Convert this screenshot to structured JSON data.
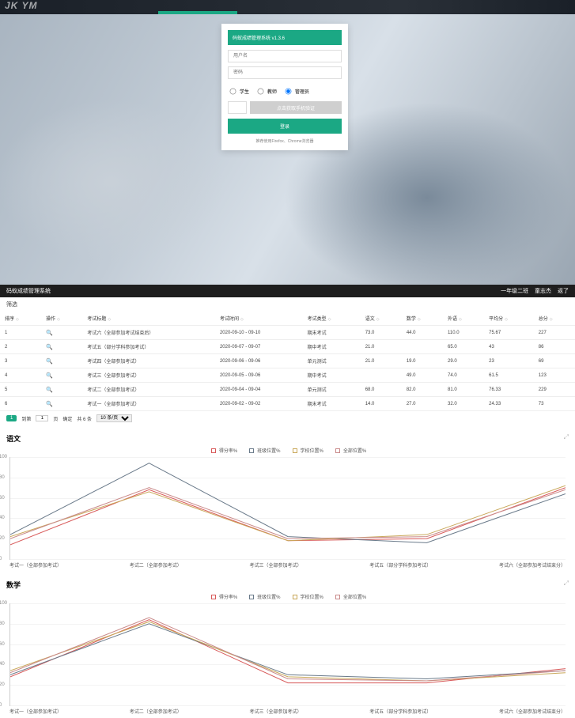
{
  "hero": {
    "brand": "JK YM"
  },
  "login": {
    "title": "码蚁成绩管理系统 v1.3.6",
    "user_ph": "用户名",
    "pass_ph": "密码",
    "role_student": "学生",
    "role_teacher": "教师",
    "role_admin": "管理员",
    "captcha_btn": "点击获取手机验证",
    "submit": "登录",
    "note": "推荐使用Firefox、Chrome浏览器"
  },
  "sysbar": {
    "title": "码蚁成绩管理系统",
    "class": "一年级二班",
    "user": "童志杰",
    "back": "返了"
  },
  "filter_label": "筛选",
  "table": {
    "headers": [
      "排序",
      "操作",
      "考试标题",
      "考试时间",
      "考试类型",
      "语文",
      "数学",
      "外语",
      "平均分",
      "总分"
    ],
    "rows": [
      {
        "idx": "1",
        "title": "考试六（全部参加考试结束后）",
        "time": "2020-09-10 - 09-10",
        "type": "期末考试",
        "yw": "73.0",
        "sx": "44.0",
        "wy": "110.0",
        "avg": "75.67",
        "total": "227"
      },
      {
        "idx": "2",
        "title": "考试五（部分学科参加考试）",
        "time": "2020-09-07 - 09-07",
        "type": "期中考试",
        "yw": "21.0",
        "sx": "",
        "wy": "65.0",
        "avg": "43",
        "total": "86"
      },
      {
        "idx": "3",
        "title": "考试四（全部参加考试）",
        "time": "2020-09-06 - 09-06",
        "type": "单元测试",
        "yw": "21.0",
        "sx": "19.0",
        "wy": "29.0",
        "avg": "23",
        "total": "69"
      },
      {
        "idx": "4",
        "title": "考试三（全部参加考试）",
        "time": "2020-09-05 - 09-06",
        "type": "期中考试",
        "yw": "",
        "sx": "49.0",
        "wy": "74.0",
        "avg": "61.5",
        "total": "123"
      },
      {
        "idx": "5",
        "title": "考试二（全部参加考试）",
        "time": "2020-09-04 - 09-04",
        "type": "单元测试",
        "yw": "68.0",
        "sx": "82.0",
        "wy": "81.0",
        "avg": "76.33",
        "total": "229"
      },
      {
        "idx": "6",
        "title": "考试一（全部参加考试）",
        "time": "2020-09-02 - 09-02",
        "type": "期末考试",
        "yw": "14.0",
        "sx": "27.0",
        "wy": "32.0",
        "avg": "24.33",
        "total": "73"
      }
    ]
  },
  "pager": {
    "goto_prefix": "到第",
    "goto_suffix": "页",
    "confirm": "确定",
    "total": "共 6 条",
    "size": "10 条/页"
  },
  "legend": [
    "得分率%",
    "班级位置%",
    "学校位置%",
    "全部位置%"
  ],
  "chart1": {
    "title": "语文"
  },
  "chart2": {
    "title": "数学"
  },
  "x_labels": [
    "考试一（全部参加考试）",
    "考试二（全部参加考试）",
    "考试三（全部参加考试）",
    "考试五（部分学科参加考试）",
    "考试六（全部参加考试结束分）"
  ],
  "chart_data": [
    {
      "type": "line",
      "title": "语文",
      "ylabel": "%",
      "ylim": [
        0,
        100
      ],
      "categories": [
        "考试一（全部参加考试）",
        "考试二（全部参加考试）",
        "考试三（全部参加考试）",
        "考试五（部分学科参加考试）",
        "考试六（全部参加考试结束分）"
      ],
      "series": [
        {
          "name": "得分率%",
          "values": [
            14,
            68,
            18,
            20,
            70
          ]
        },
        {
          "name": "班级位置%",
          "values": [
            24,
            94,
            22,
            16,
            64
          ]
        },
        {
          "name": "学校位置%",
          "values": [
            22,
            66,
            18,
            24,
            72
          ]
        },
        {
          "name": "全部位置%",
          "values": [
            20,
            70,
            20,
            22,
            68
          ]
        }
      ]
    },
    {
      "type": "line",
      "title": "数学",
      "ylabel": "%",
      "ylim": [
        0,
        100
      ],
      "categories": [
        "考试一（全部参加考试）",
        "考试二（全部参加考试）",
        "考试三（全部参加考试）",
        "考试五（部分学科参加考试）",
        "考试六（全部参加考试结束分）"
      ],
      "series": [
        {
          "name": "得分率%",
          "values": [
            28,
            84,
            22,
            22,
            36
          ]
        },
        {
          "name": "班级位置%",
          "values": [
            30,
            80,
            30,
            26,
            34
          ]
        },
        {
          "name": "学校位置%",
          "values": [
            34,
            82,
            28,
            24,
            32
          ]
        },
        {
          "name": "全部位置%",
          "values": [
            32,
            86,
            26,
            24,
            34
          ]
        }
      ]
    }
  ]
}
